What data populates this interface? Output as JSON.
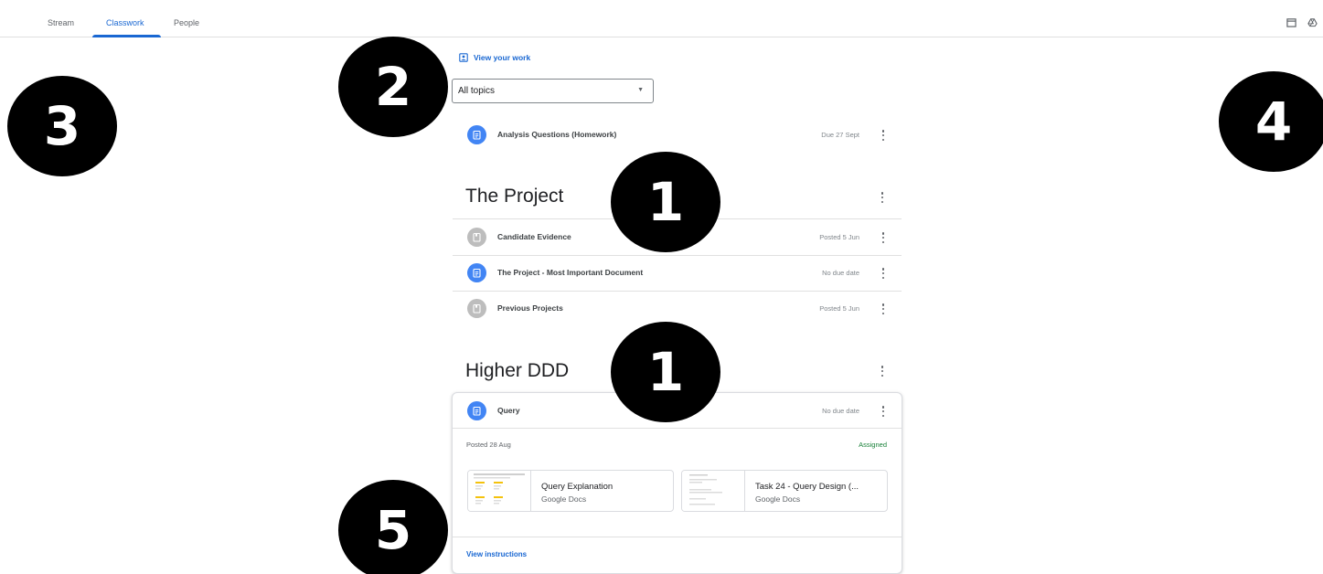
{
  "nav": {
    "tabs": [
      {
        "label": "Stream"
      },
      {
        "label": "Classwork"
      },
      {
        "label": "People"
      }
    ],
    "icons": [
      "calendar-icon",
      "drive-icon"
    ]
  },
  "view_work": {
    "label": "View your work"
  },
  "topic_filter": {
    "value": "All topics"
  },
  "ungrouped": [
    {
      "title": "Analysis Questions (Homework)",
      "due": "Due 27 Sept",
      "icon": "assignment"
    }
  ],
  "topics": [
    {
      "name": "The Project",
      "items": [
        {
          "title": "Candidate Evidence",
          "due": "Posted 5 Jun",
          "icon": "material"
        },
        {
          "title": "The Project - Most Important Document",
          "due": "No due date",
          "icon": "assignment"
        },
        {
          "title": "Previous Projects",
          "due": "Posted 5 Jun",
          "icon": "material"
        }
      ]
    },
    {
      "name": "Higher DDD",
      "items": [
        {
          "title": "Query",
          "due": "No due date",
          "icon": "assignment",
          "posted": "Posted 28 Aug",
          "status": "Assigned",
          "attachments": [
            {
              "title": "Query Explanation",
              "type": "Google Docs"
            },
            {
              "title": "Task 24 - Query Design (...",
              "type": "Google Docs"
            }
          ],
          "action": "View instructions"
        }
      ]
    }
  ],
  "callouts": [
    "1",
    "1",
    "2",
    "3",
    "4",
    "5"
  ],
  "colors": {
    "accent": "#1967d2",
    "assignment_icon": "#4285f4",
    "material_icon": "#bdbdbd",
    "assigned": "#188038"
  }
}
